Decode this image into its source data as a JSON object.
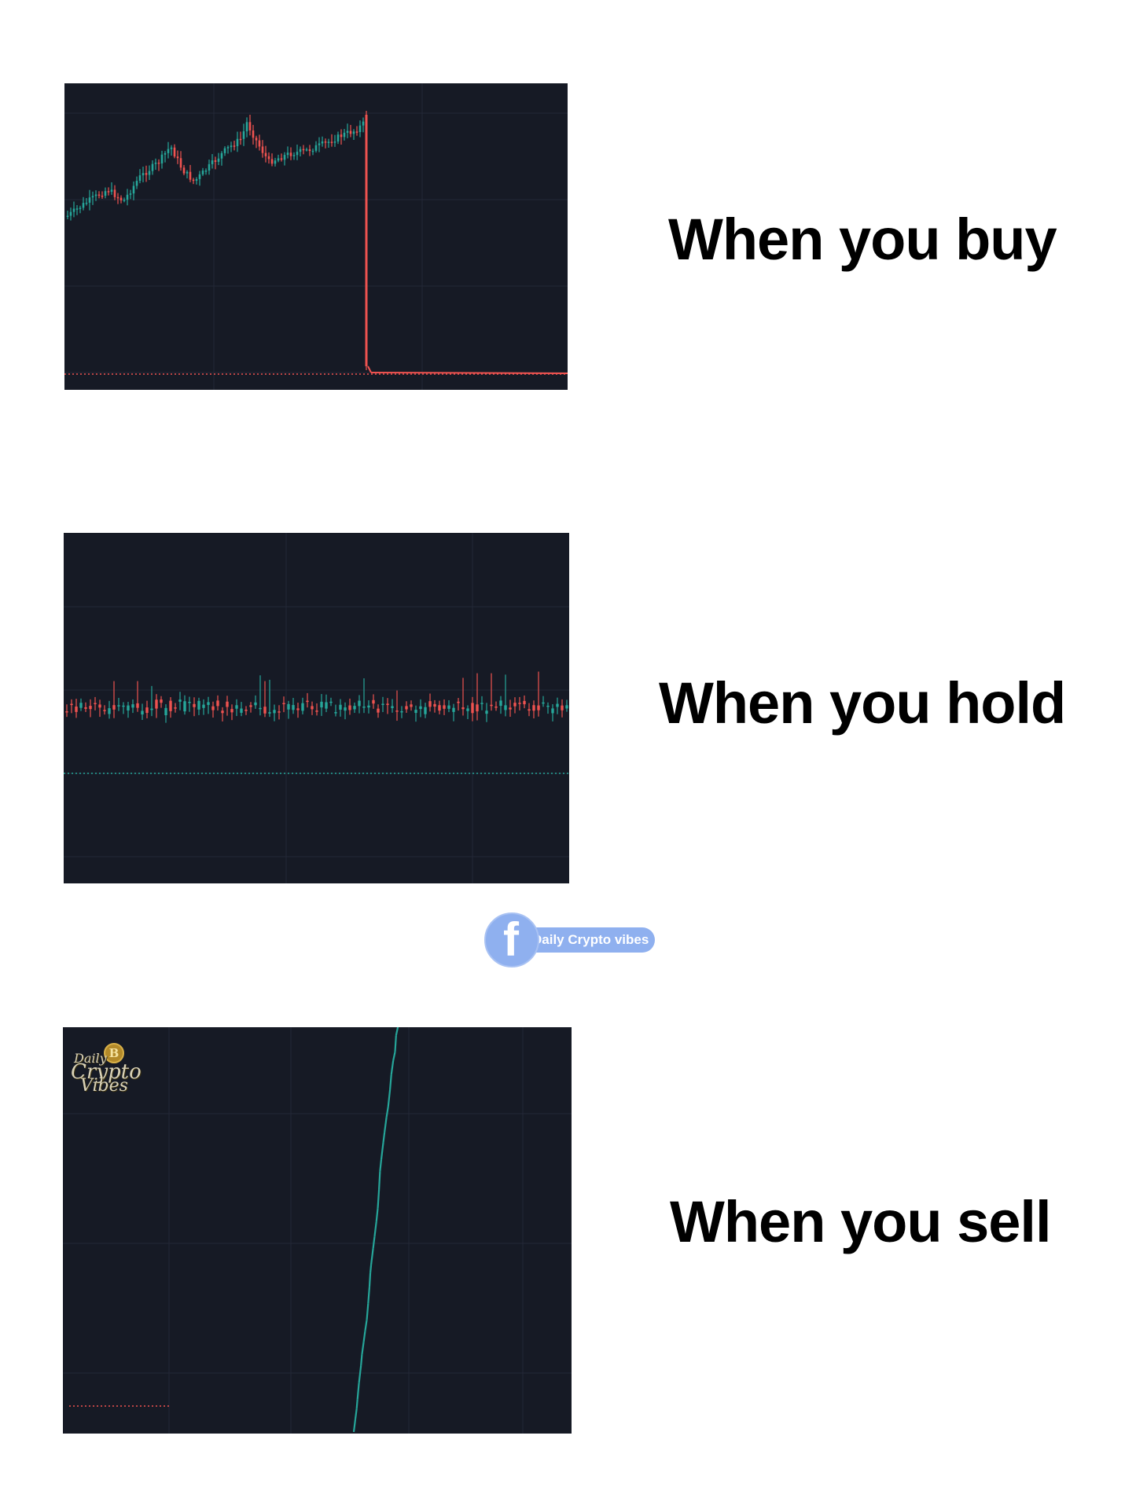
{
  "captions": {
    "buy": "When you buy",
    "hold": "When you hold",
    "sell": "When you sell"
  },
  "badge": {
    "text": "Daily Crypto vibes",
    "icon": "facebook-icon",
    "color": "#8fb0ef"
  },
  "watermark": {
    "line1": "Daily",
    "line2": "Crypto",
    "line3": "Vibes",
    "icon": "bitcoin-coin-icon"
  },
  "colors": {
    "panel_bg": "#161a25",
    "grid": "#232836",
    "up": "#26a69a",
    "down": "#ef5350"
  }
}
